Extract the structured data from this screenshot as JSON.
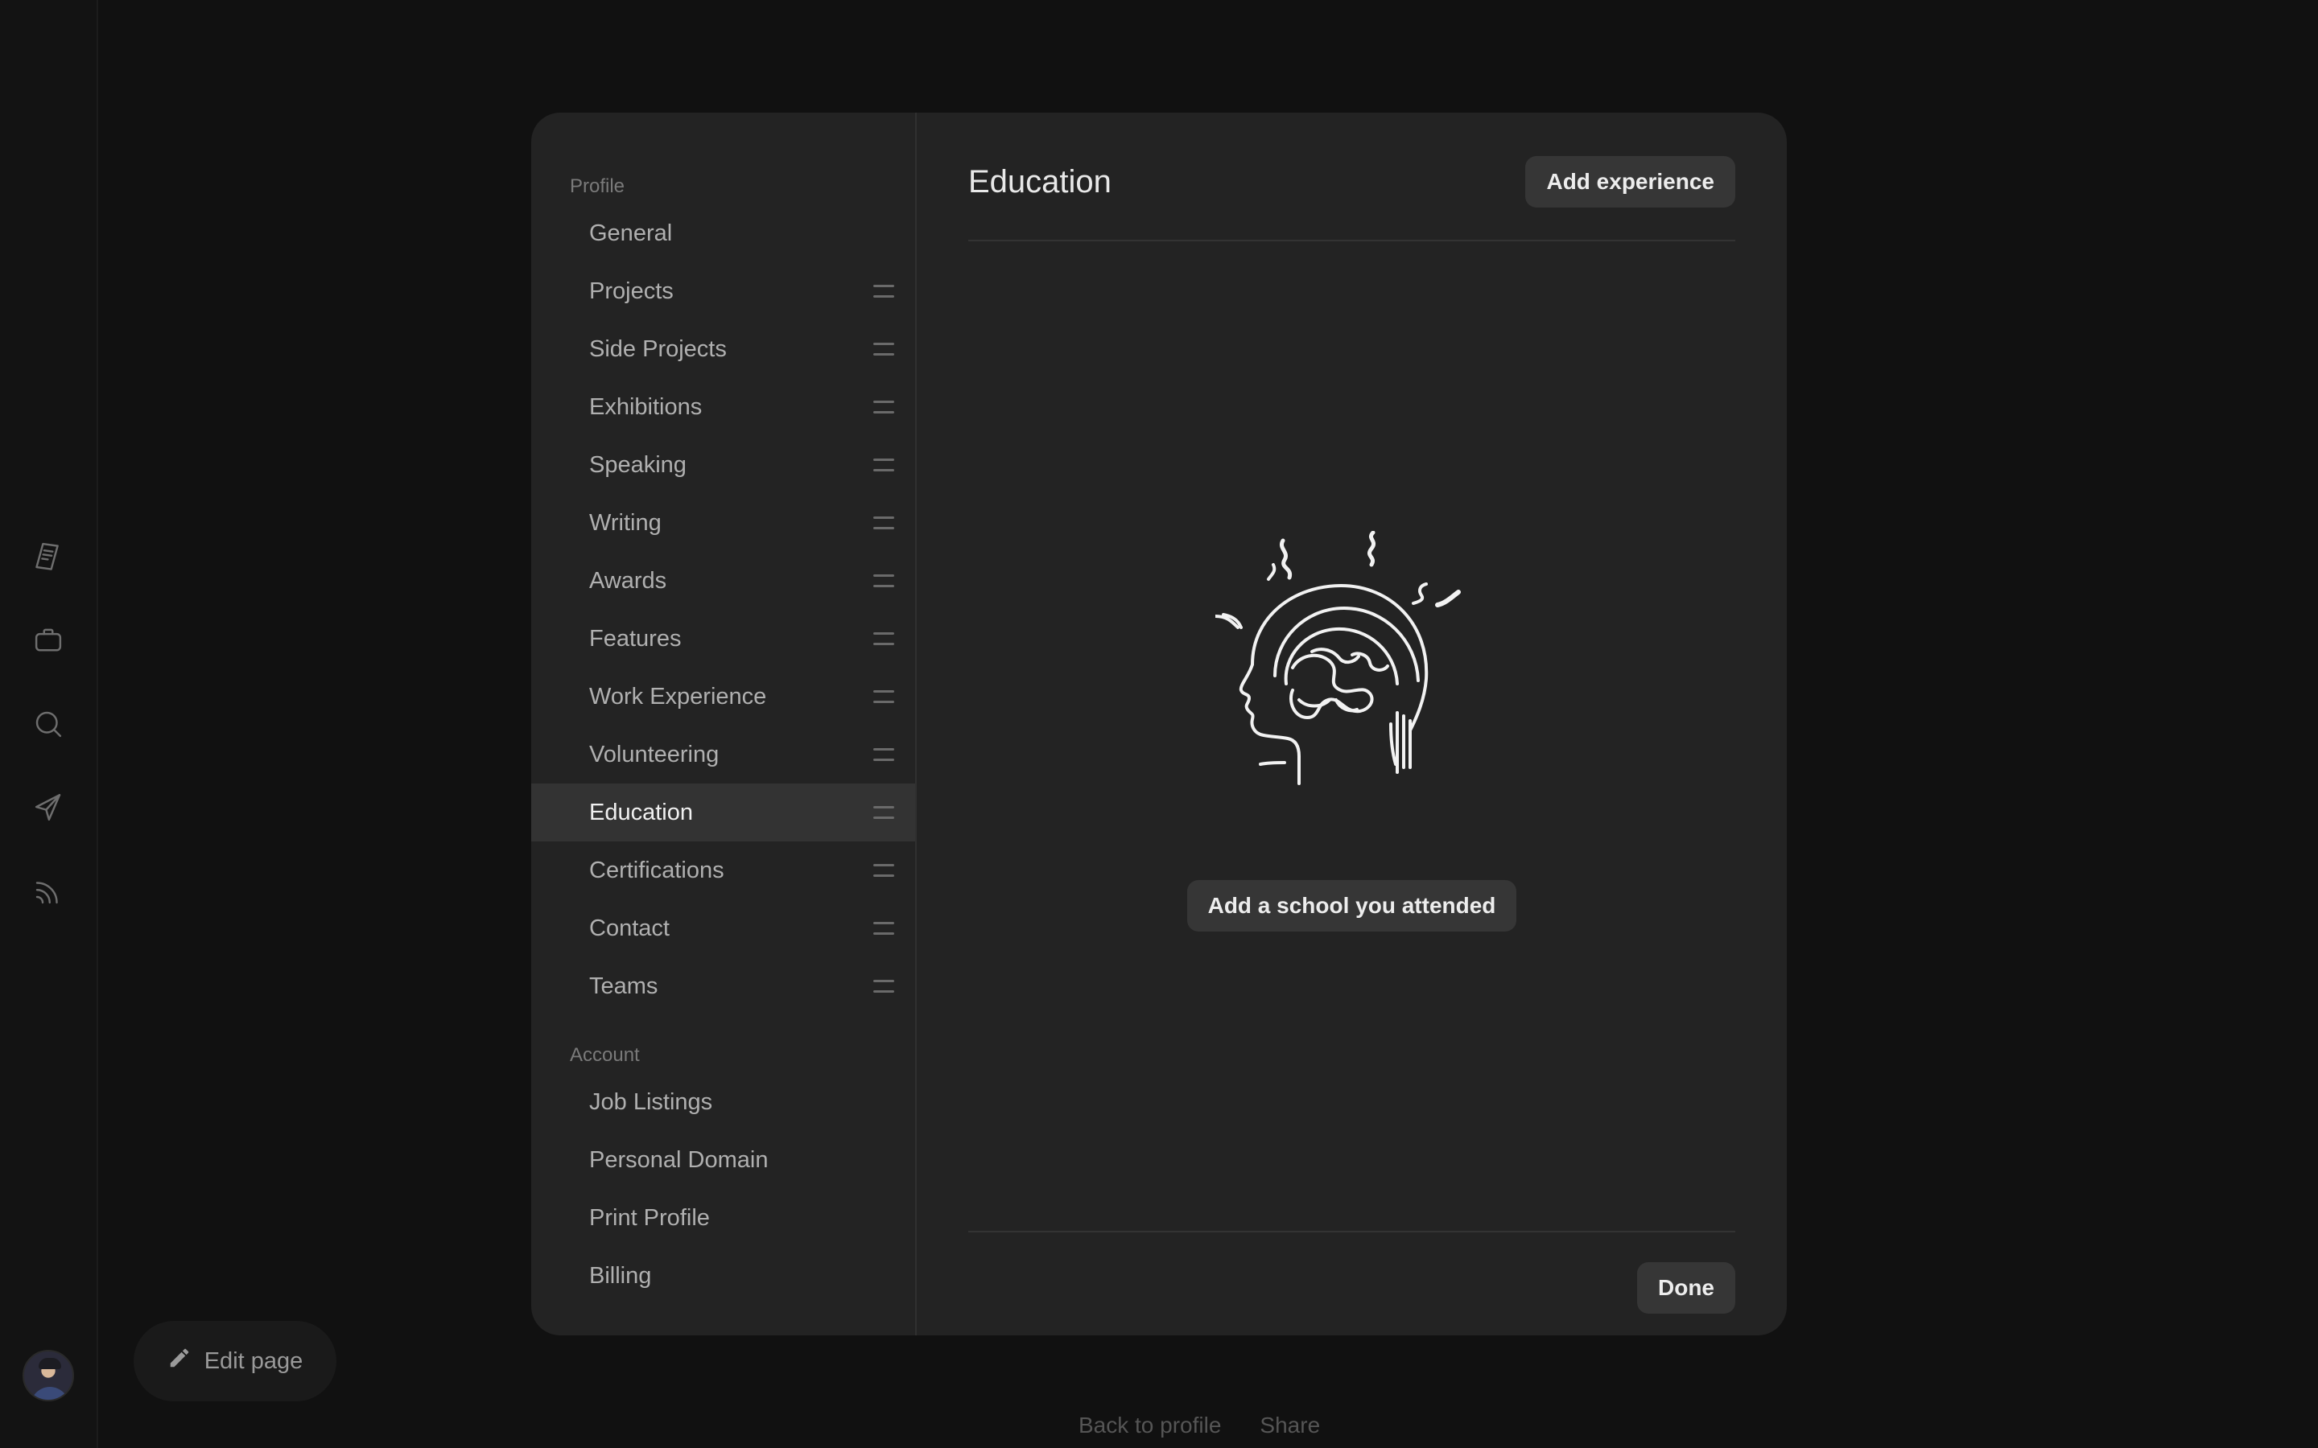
{
  "rail": {
    "icons": [
      "document-icon",
      "briefcase-icon",
      "search-icon",
      "send-icon",
      "rss-icon"
    ]
  },
  "edit_page": {
    "label": "Edit page"
  },
  "bottom_links": {
    "back": "Back to profile",
    "share": "Share"
  },
  "sidebar": {
    "profile_label": "Profile",
    "profile_items": [
      {
        "label": "General",
        "draggable": false
      },
      {
        "label": "Projects",
        "draggable": true
      },
      {
        "label": "Side Projects",
        "draggable": true
      },
      {
        "label": "Exhibitions",
        "draggable": true
      },
      {
        "label": "Speaking",
        "draggable": true
      },
      {
        "label": "Writing",
        "draggable": true
      },
      {
        "label": "Awards",
        "draggable": true
      },
      {
        "label": "Features",
        "draggable": true
      },
      {
        "label": "Work Experience",
        "draggable": true
      },
      {
        "label": "Volunteering",
        "draggable": true
      },
      {
        "label": "Education",
        "draggable": true,
        "active": true
      },
      {
        "label": "Certifications",
        "draggable": true
      },
      {
        "label": "Contact",
        "draggable": true
      },
      {
        "label": "Teams",
        "draggable": true
      }
    ],
    "account_label": "Account",
    "account_items": [
      {
        "label": "Job Listings"
      },
      {
        "label": "Personal Domain"
      },
      {
        "label": "Print Profile"
      },
      {
        "label": "Billing"
      }
    ]
  },
  "main": {
    "title": "Education",
    "add_button": "Add experience",
    "empty_button": "Add a school you attended",
    "done_button": "Done"
  },
  "colors": {
    "background": "#111111",
    "modal": "#232323",
    "active_item": "#333333",
    "button": "#363636"
  }
}
